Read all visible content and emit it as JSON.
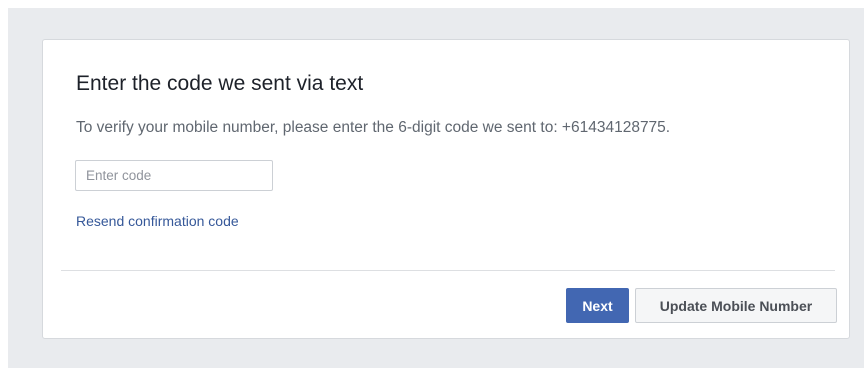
{
  "dialog": {
    "title": "Enter the code we sent via text",
    "description": "To verify your mobile number, please enter the 6-digit code we sent to: +61434128775.",
    "code_input": {
      "placeholder": "Enter code",
      "value": ""
    },
    "resend_link": "Resend confirmation code",
    "buttons": {
      "next": "Next",
      "update_mobile": "Update Mobile Number"
    }
  },
  "colors": {
    "page_background": "#e9ebee",
    "primary_button": "#4267b2",
    "link": "#365899",
    "secondary_button": "#f5f6f7"
  }
}
